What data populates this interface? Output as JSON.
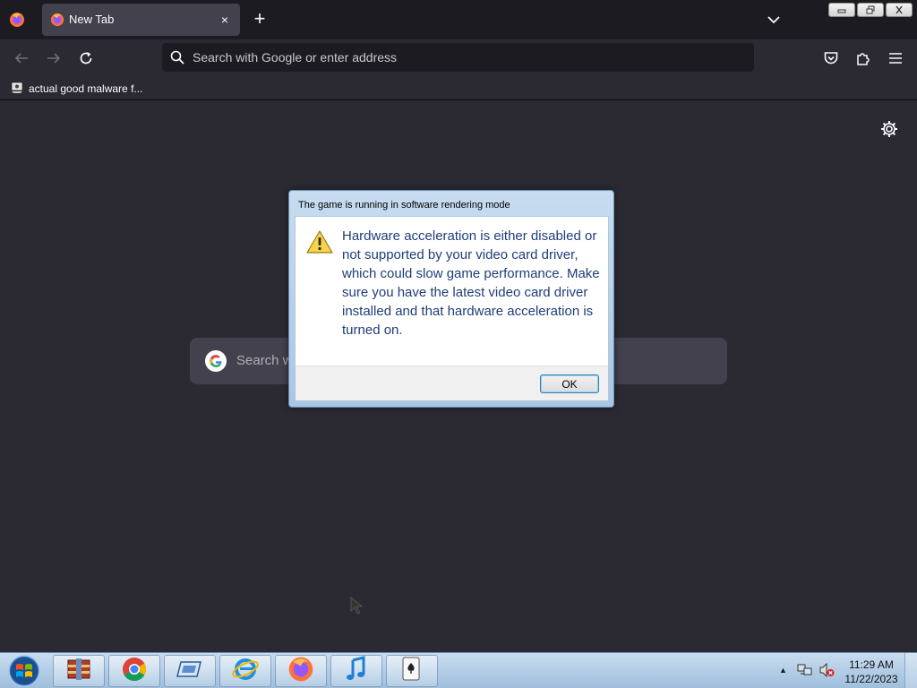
{
  "browser": {
    "tab": {
      "title": "New Tab",
      "close_label": "×"
    },
    "new_tab_label": "+",
    "urlbar": {
      "placeholder": "Search with Google or enter address"
    },
    "bookmarks": [
      {
        "label": "actual good malware f..."
      }
    ]
  },
  "newtab_page": {
    "search_placeholder": "Search w"
  },
  "dialog": {
    "title": "The game is running in software rendering mode",
    "message": "Hardware acceleration is either disabled or not supported by your video card driver, which could slow game performance. Make sure you have the latest video card driver installed and that hardware acceleration is turned on.",
    "ok_label": "OK"
  },
  "taskbar": {
    "items": [
      {
        "icon": "archive-app-icon"
      },
      {
        "icon": "chrome-icon"
      },
      {
        "icon": "drive-app-icon"
      },
      {
        "icon": "internet-explorer-icon"
      },
      {
        "icon": "firefox-icon"
      },
      {
        "icon": "itunes-icon"
      },
      {
        "icon": "solitaire-icon"
      }
    ],
    "clock": {
      "time": "11:29 AM",
      "date": "11/22/2023"
    }
  },
  "colors": {
    "tabstrip_bg": "#1c1b22",
    "toolbar_bg": "#2b2a33",
    "tab_bg": "#42414d",
    "dialog_text": "#1f3d7a"
  }
}
